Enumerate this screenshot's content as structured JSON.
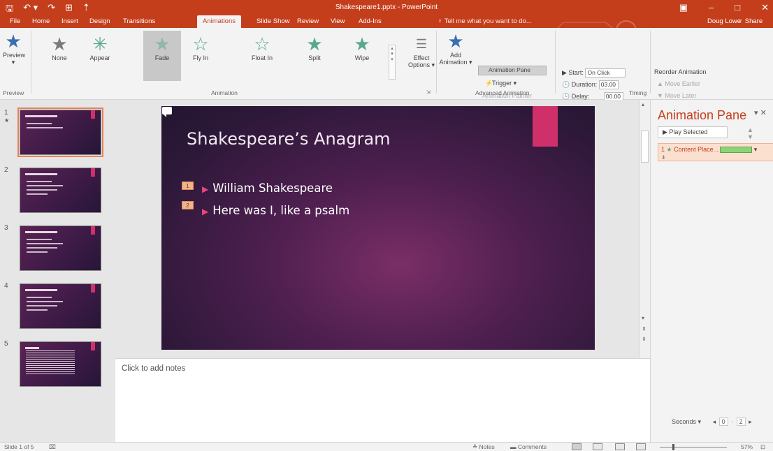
{
  "titlebar": {
    "qat": {
      "save": "🖫",
      "undo": "↶ ▾",
      "redo": "↷",
      "start": "⊞",
      "more": "⇡"
    },
    "doc_title": "Shakespeare1.pptx - PowerPoint",
    "winctl": {
      "ribbon_opts": "▣",
      "minimize": "–",
      "restore": "□",
      "close": "✕"
    }
  },
  "tabs": {
    "file": "File",
    "home": "Home",
    "insert": "Insert",
    "design": "Design",
    "transitions": "Transitions",
    "animations": "Animations",
    "slideshow": "Slide Show",
    "review": "Review",
    "view": "View",
    "addins": "Add-Ins",
    "tell_me": "♀ Tell me what you want to do...",
    "user": "Doug Lowe",
    "share": "♀ Share"
  },
  "ribbon": {
    "preview": {
      "label": "Preview",
      "arrow": "▾",
      "group": "Preview"
    },
    "gallery": [
      {
        "label": "None"
      },
      {
        "label": "Appear"
      },
      {
        "label": "Fade"
      },
      {
        "label": "Fly In"
      },
      {
        "label": "Float In"
      },
      {
        "label": "Split"
      },
      {
        "label": "Wipe"
      }
    ],
    "effect_options": "Effect Options ▾",
    "animation_group": "Animation",
    "add_animation": "Add Animation ▾",
    "animation_pane": "Animation Pane",
    "trigger": "Trigger ▾",
    "animation_painter": "Animation Painter",
    "advanced_group": "Advanced Animation",
    "start_label": "▶ Start:",
    "start_value": "On Click",
    "duration_label": "🕓 Duration:",
    "duration_value": "03.00",
    "delay_label": "🕓 Delay:",
    "delay_value": "00.00",
    "timing_group": "Timing",
    "reorder": "Reorder Animation",
    "move_earlier": "▲ Move Earlier",
    "move_later": "▼ Move Later"
  },
  "thumbnails": [
    {
      "num": "1",
      "star": "★"
    },
    {
      "num": "2"
    },
    {
      "num": "3"
    },
    {
      "num": "4"
    },
    {
      "num": "5"
    }
  ],
  "slide": {
    "title": "Shakespeare’s Anagram",
    "bullets": [
      {
        "tag": "1",
        "arrow": "▶",
        "text": "William Shakespeare"
      },
      {
        "tag": "2",
        "arrow": "▶",
        "text": "Here was I, like a psalm"
      }
    ]
  },
  "notes": {
    "placeholder": "Click to add notes"
  },
  "animation_pane": {
    "title": "Animation Pane",
    "controls": "▾ ✕",
    "play_selected": "▶ Play Selected",
    "order_arrows": "▲ ▼",
    "item": {
      "num": "1",
      "star": "★",
      "label": "Content Place...",
      "dropdown": "▾",
      "sub": "⇟"
    },
    "seconds_label": "Seconds ▾",
    "seconds_start": "0",
    "seconds_end": "2"
  },
  "status": {
    "slide": "Slide 1 of 5",
    "notes": "≜ Notes",
    "comments": "▬ Comments",
    "zoom": "57%"
  },
  "colors": {
    "accent": "#c43e1c",
    "slide_bar": "#d0306a",
    "anim_green": "#8ed37a"
  }
}
